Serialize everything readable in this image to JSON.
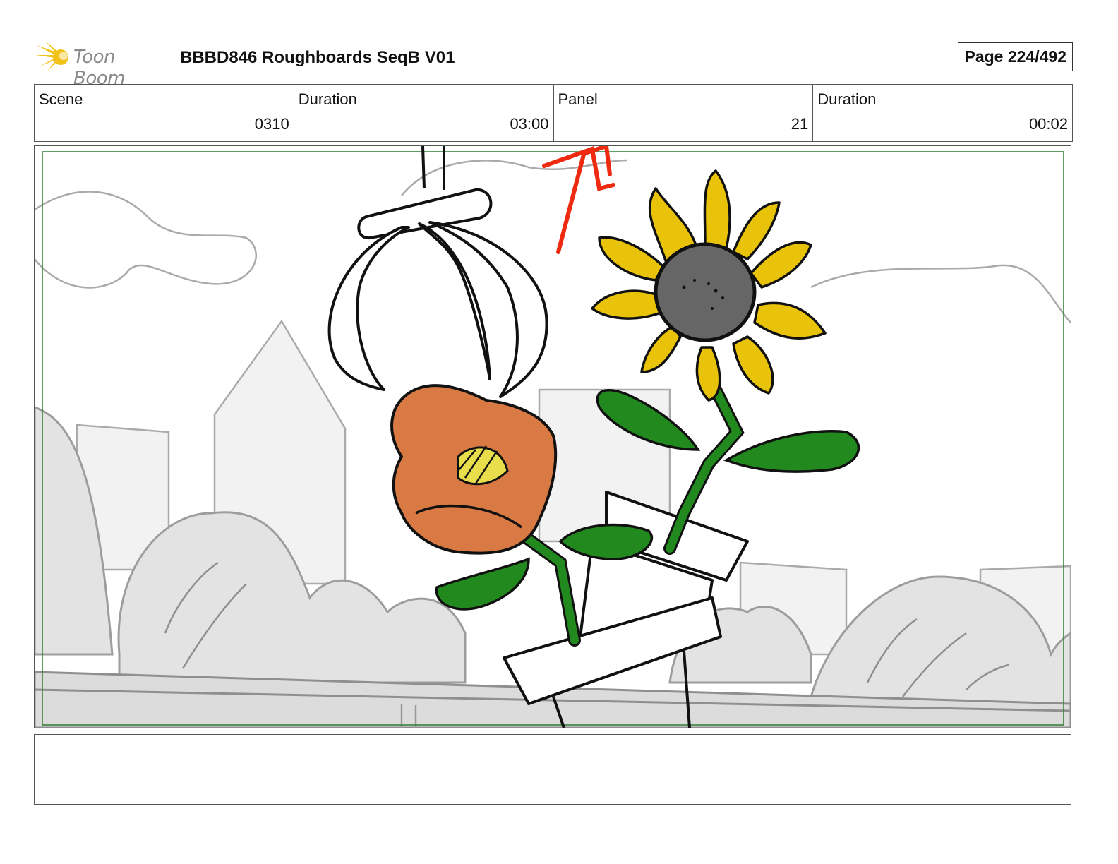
{
  "header": {
    "logo_text": "Toon Boom",
    "project_title": "BBBD846 Roughboards SeqB V01",
    "page_label": "Page 224/492"
  },
  "info": {
    "scene_label": "Scene",
    "scene_value": "0310",
    "scene_duration_label": "Duration",
    "scene_duration_value": "03:00",
    "panel_label": "Panel",
    "panel_value": "21",
    "panel_duration_label": "Duration",
    "panel_duration_value": "00:02"
  },
  "notes": {
    "text": ""
  },
  "colors": {
    "safe_frame": "#2e7d32",
    "sunflower_petals": "#e9c20a",
    "sunflower_center": "#666666",
    "poppy": "#d97a45",
    "leaf": "#22891f",
    "arrow": "#ee2a10"
  }
}
